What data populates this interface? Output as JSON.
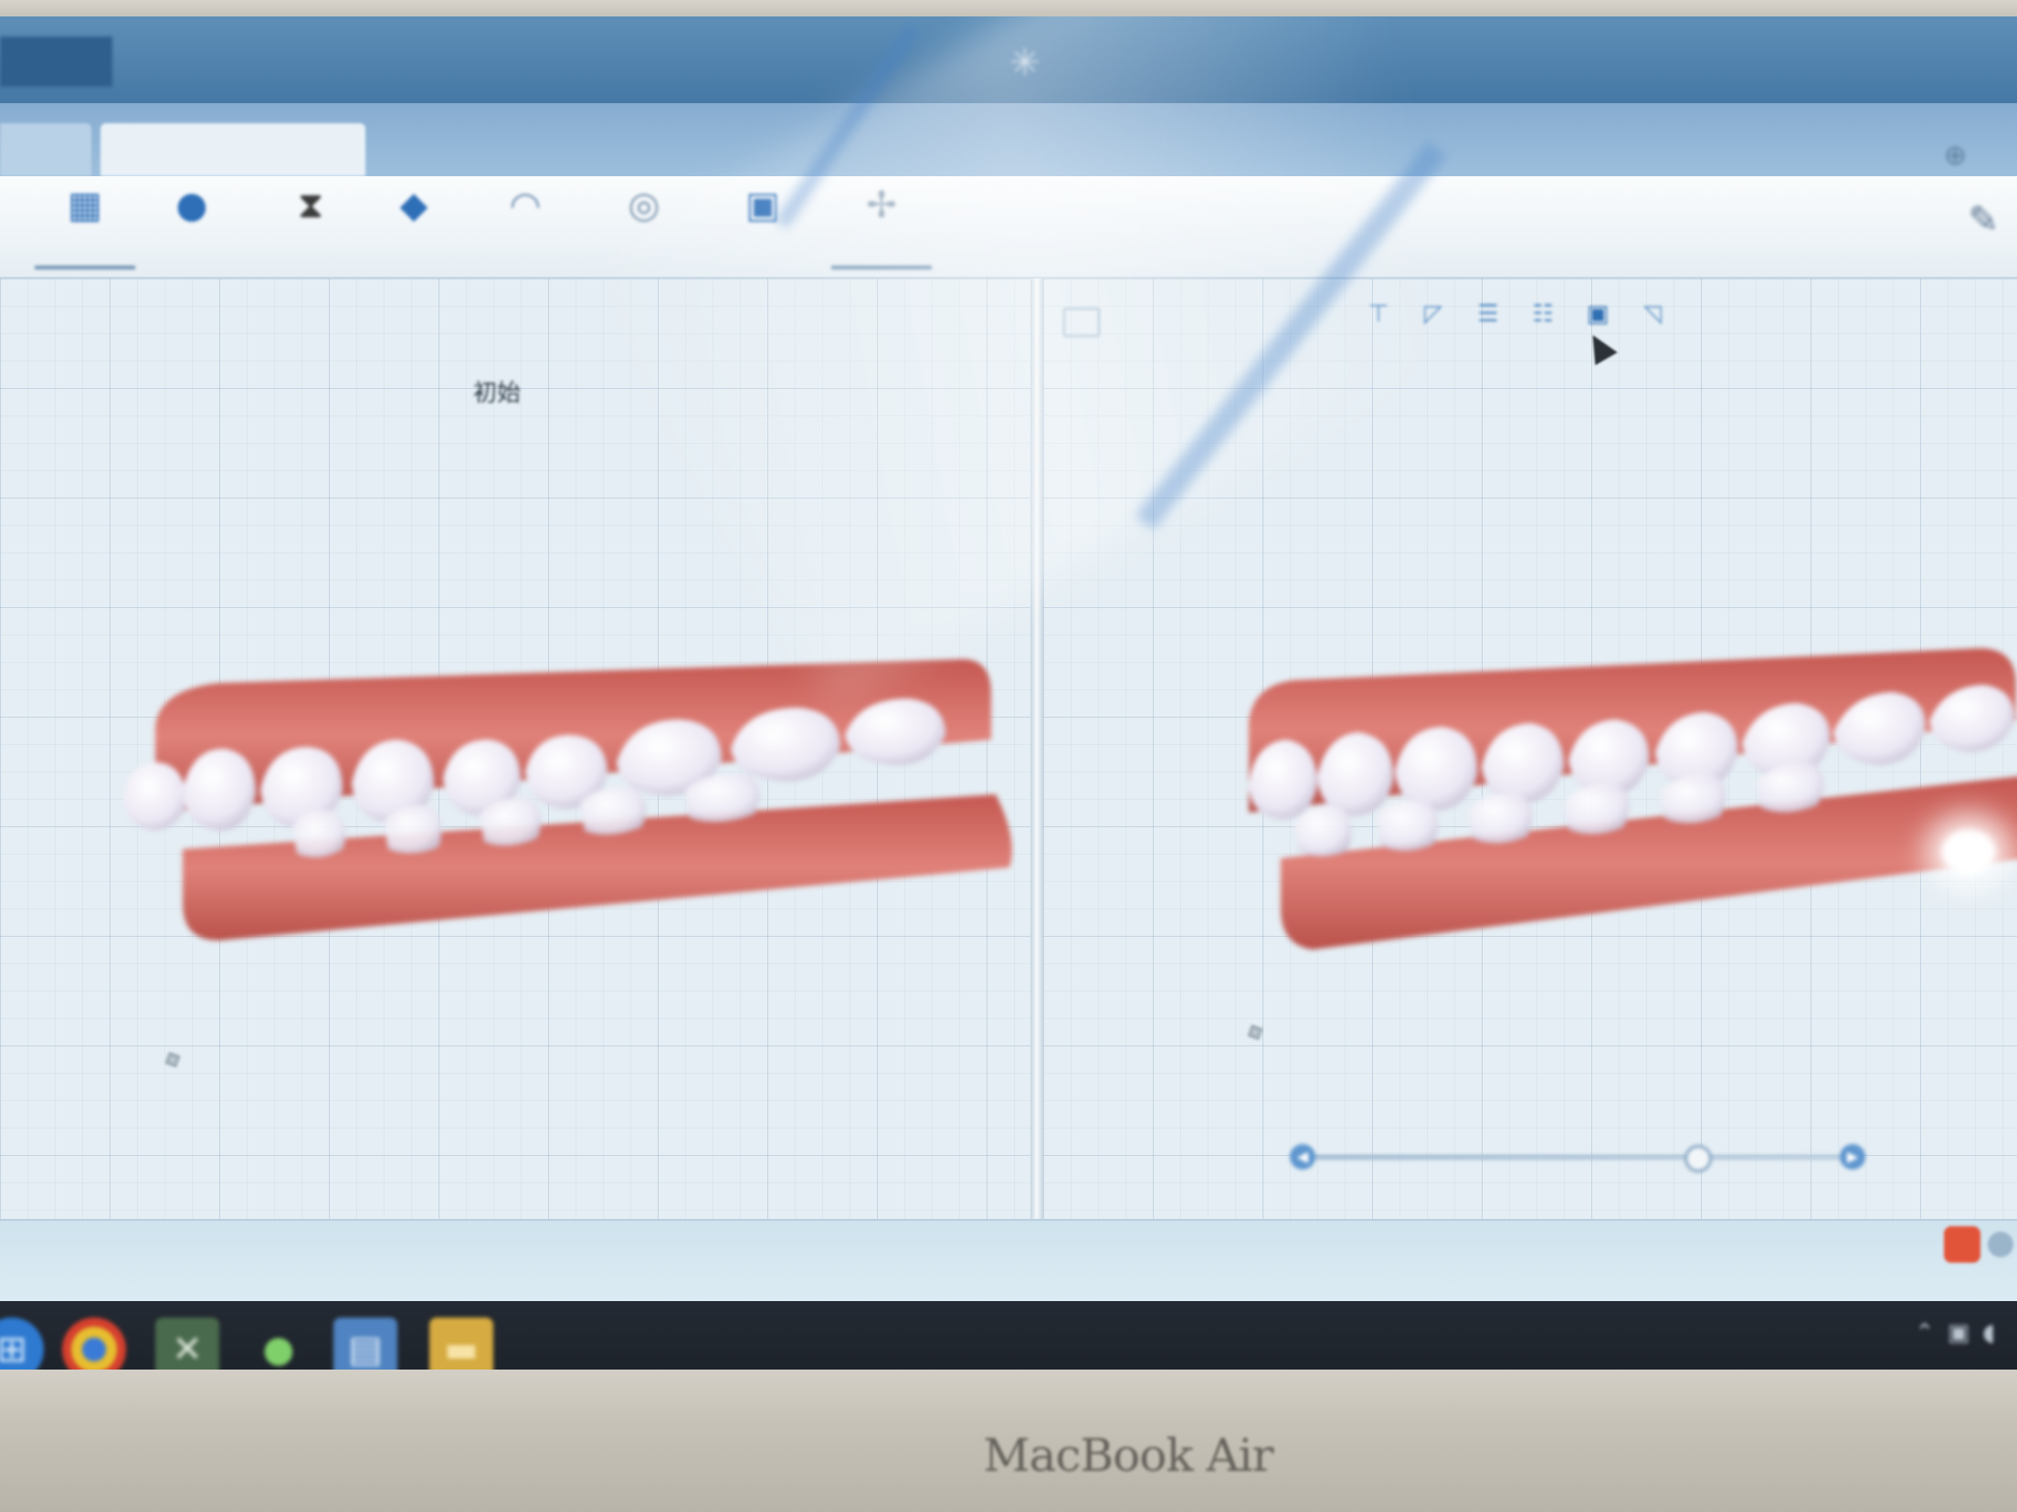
{
  "laptop": {
    "brand": "MacBook Air"
  },
  "window": {
    "title_left": "",
    "info_lines": [
      "",
      ""
    ],
    "app_name": "",
    "title_right": ""
  },
  "tabs": [
    {
      "label": ""
    },
    {
      "label": ""
    }
  ],
  "ribbon": {
    "tools": [
      {
        "icon": "grid-icon",
        "label": ""
      },
      {
        "icon": "drop-icon",
        "label": ""
      },
      {
        "icon": "tooth-compare-icon",
        "label": ""
      },
      {
        "icon": "diamond-icon",
        "label": ""
      },
      {
        "icon": "arch-icon",
        "label": ""
      },
      {
        "icon": "measure-icon",
        "label": ""
      },
      {
        "icon": "chart-icon",
        "label": ""
      },
      {
        "icon": "tool-icon",
        "label": ""
      }
    ]
  },
  "viewports": {
    "left": {
      "title": "初始"
    },
    "right": {
      "title": ""
    }
  },
  "view_buttons": [
    "view-front-icon",
    "view-left-icon",
    "view-top-icon",
    "view-bottom-icon",
    "view-right-icon",
    "view-side-icon"
  ],
  "stage_slider": {
    "position": 0.75
  },
  "status": {
    "text": ""
  },
  "colors": {
    "accent": "#2f6fb3",
    "gum": "#d0675e",
    "tooth": "#f1eef7"
  }
}
